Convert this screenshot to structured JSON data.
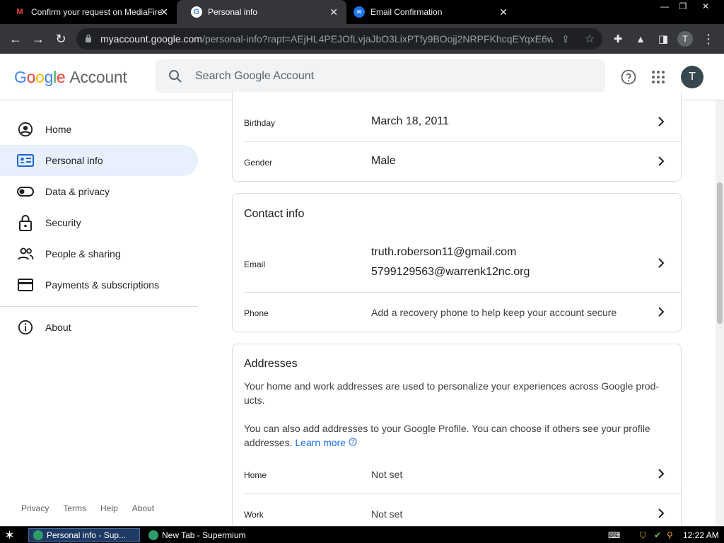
{
  "browser": {
    "tabs": [
      {
        "title": "Confirm your request on MediaFire",
        "icon": "gmail-icon"
      },
      {
        "title": "Personal info",
        "icon": "google-icon"
      },
      {
        "title": "Email Confirmation",
        "icon": "mail-icon"
      }
    ],
    "active_tab": 1,
    "url_domain": "myaccount.google.com",
    "url_path": "/personal-info?rapt=AEjHL4PEJOfLvjaJbO3LixPTfy9BOojj2NRPFKhcqEYqxE6w...",
    "profile_initial": "T"
  },
  "header": {
    "logo_google": "Google",
    "logo_account": "Account",
    "search_placeholder": "Search Google Account",
    "avatar_initial": "T"
  },
  "sidebar": {
    "items": [
      {
        "label": "Home",
        "icon": "person-circle-icon"
      },
      {
        "label": "Personal info",
        "icon": "id-card-icon"
      },
      {
        "label": "Data & privacy",
        "icon": "toggle-icon"
      },
      {
        "label": "Security",
        "icon": "lock-icon"
      },
      {
        "label": "People & sharing",
        "icon": "people-icon"
      },
      {
        "label": "Payments & subscriptions",
        "icon": "credit-card-icon"
      },
      {
        "label": "About",
        "icon": "info-icon"
      }
    ],
    "active_index": 1,
    "footer": [
      "Privacy",
      "Terms",
      "Help",
      "About"
    ]
  },
  "basic_info": {
    "birthday_label": "Birthday",
    "birthday_value": "March 18, 2011",
    "gender_label": "Gender",
    "gender_value": "Male"
  },
  "contact_info": {
    "title": "Contact info",
    "email_label": "Email",
    "email_primary": "truth.roberson11@gmail.com",
    "email_secondary": "5799129563@warrenk12nc.org",
    "phone_label": "Phone",
    "phone_value": "Add a recovery phone to help keep your account secure"
  },
  "addresses": {
    "title": "Addresses",
    "desc1": "Your home and work addresses are used to personalize your experiences across Google prod-ucts.",
    "desc2": "You can also add addresses to your Google Profile. You can choose if others see your profile addresses.",
    "learn_more": "Learn more",
    "home_label": "Home",
    "home_value": "Not set",
    "work_label": "Work",
    "work_value": "Not set"
  },
  "taskbar": {
    "tasks": [
      "Personal info - Sup...",
      "New Tab - Supermium"
    ],
    "clock": "12:22 AM"
  }
}
